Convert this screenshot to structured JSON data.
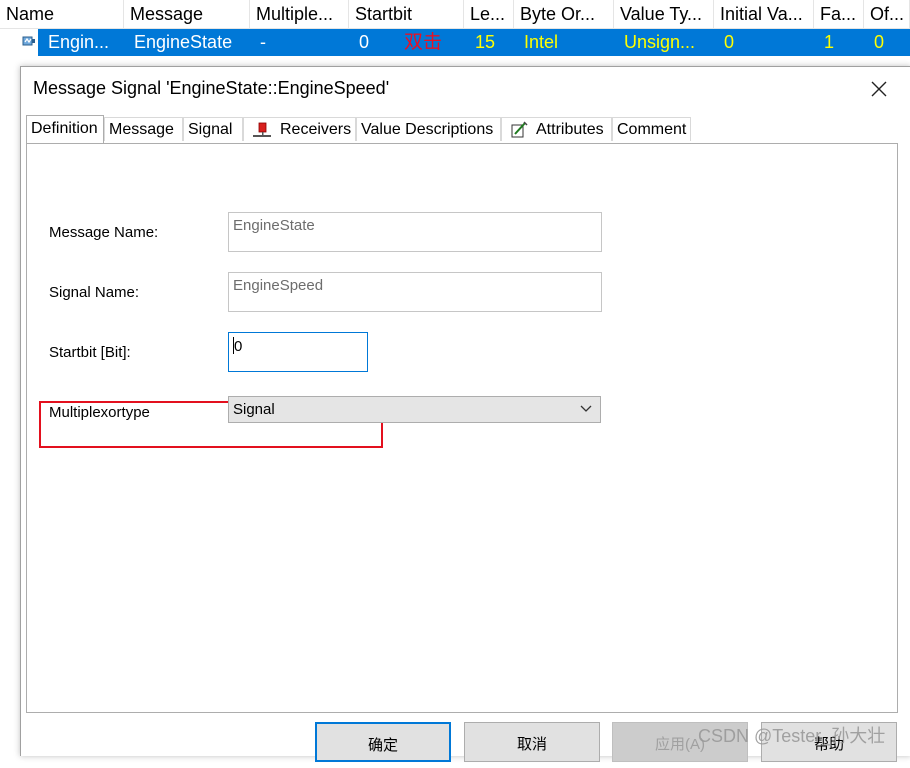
{
  "grid": {
    "columns": [
      "Name",
      "Message",
      "Multiple...",
      "Startbit",
      "Le...",
      "Byte Or...",
      "Value Ty...",
      "Initial Va...",
      "Fa...",
      "Of..."
    ],
    "row": {
      "name": "Engin...",
      "message": "EngineState",
      "multiplexor": "-",
      "startbit": "0",
      "length": "15",
      "byte_order": "Intel",
      "value_type": "Unsign...",
      "initial_value": "0",
      "factor": "1",
      "offset": "0"
    },
    "annotation": "双击"
  },
  "dialog": {
    "title": "Message Signal 'EngineState::EngineSpeed'",
    "tabs": [
      "Definition",
      "Message",
      "Signal",
      "Receivers",
      "Value Descriptions",
      "Attributes",
      "Comment"
    ],
    "active_tab": "Definition",
    "fields": {
      "message_name_label": "Message Name:",
      "message_name_value": "EngineState",
      "signal_name_label": "Signal Name:",
      "signal_name_value": "EngineSpeed",
      "startbit_label": "Startbit [Bit]:",
      "startbit_value": "0",
      "multiplexortype_label": "Multiplexortype",
      "multiplexortype_value": "Signal"
    },
    "buttons": {
      "ok": "确定",
      "cancel": "取消",
      "apply": "应用(A)",
      "help": "帮助"
    }
  },
  "watermark": "CSDN @Tester_孙大壮",
  "colors": {
    "selection": "#0078d7",
    "highlight_text": "#ffff00",
    "annotation_red": "#e81123"
  }
}
